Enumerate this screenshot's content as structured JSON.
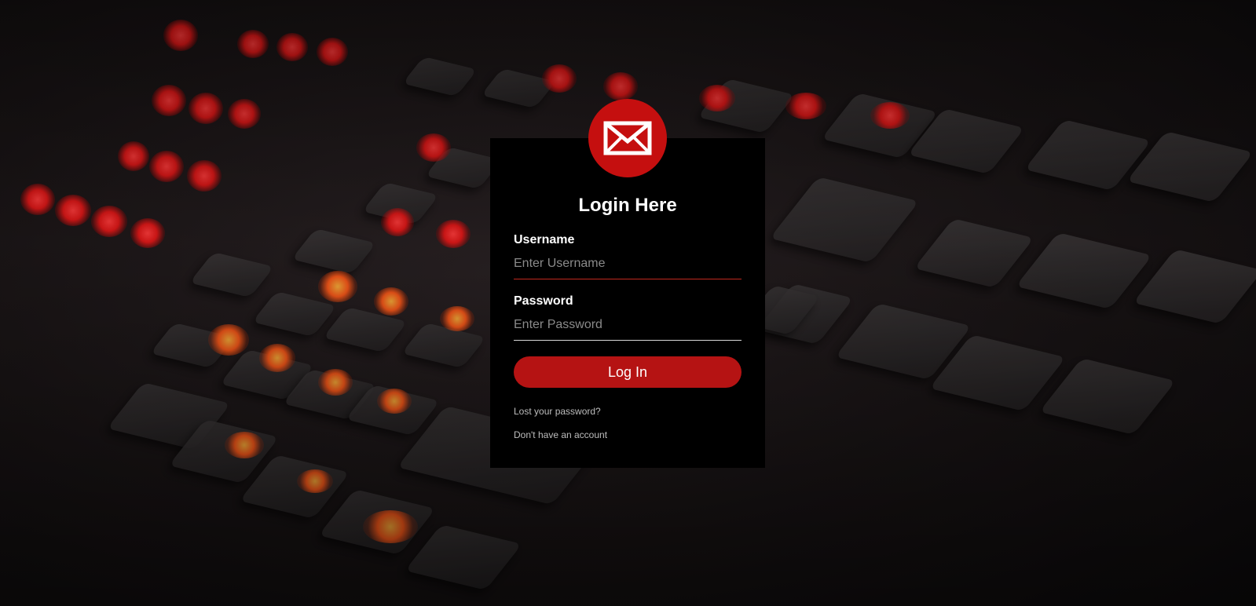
{
  "login": {
    "icon": "envelope-icon",
    "title": "Login Here",
    "username_label": "Username",
    "username_placeholder": "Enter Username",
    "password_label": "Password",
    "password_placeholder": "Enter Password",
    "submit_label": "Log In",
    "lost_password_link": "Lost your password?",
    "signup_link": "Don't have an account"
  },
  "colors": {
    "accent": "#c50f0f",
    "button": "#b51313",
    "card": "#000000"
  }
}
